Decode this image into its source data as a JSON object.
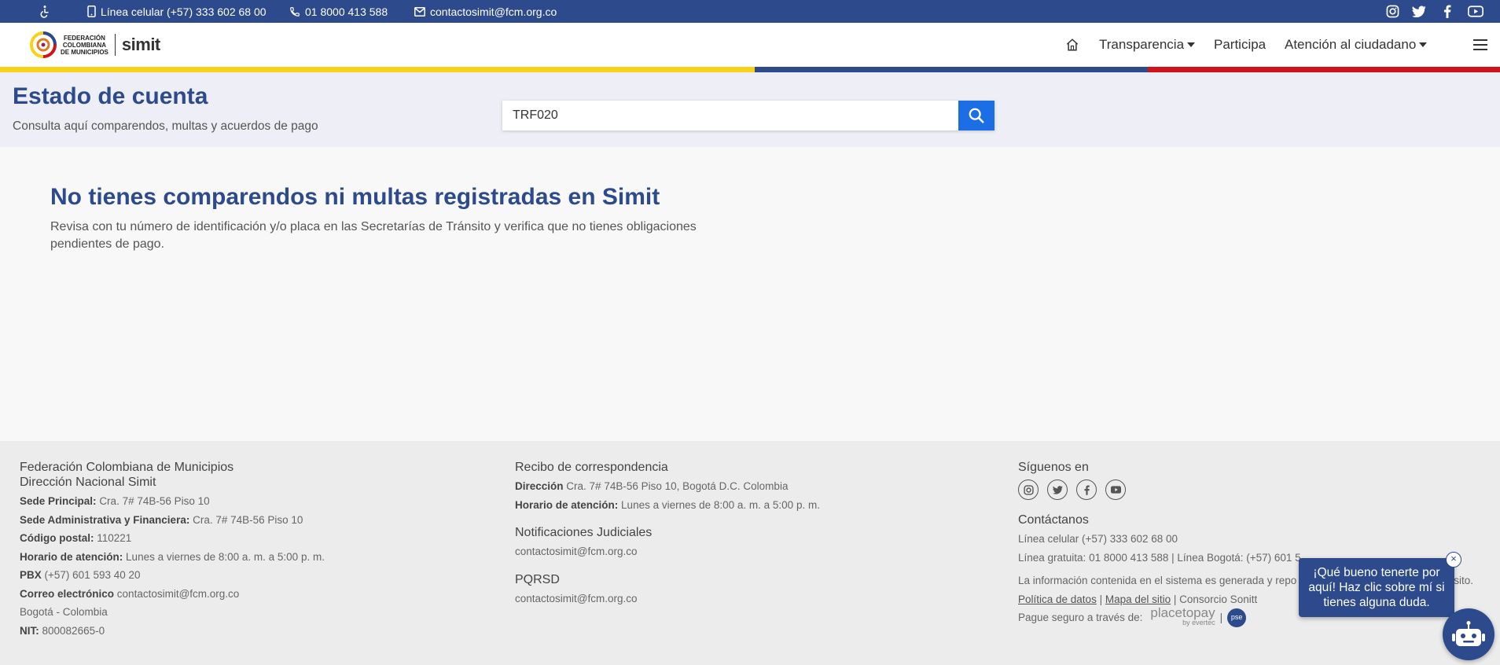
{
  "topbar": {
    "accessibility_icon": "wheelchair-icon",
    "phone_mobile": "Línea celular (+57) 333 602 68 00",
    "phone_line": "01 8000 413 588",
    "email": "contactosimit@fcm.org.co",
    "social_icons": [
      "instagram-icon",
      "twitter-icon",
      "facebook-icon",
      "youtube-icon"
    ]
  },
  "header": {
    "logo_text": [
      "FEDERACIÓN",
      "COLOMBIANA",
      "DE MUNICIPIOS"
    ],
    "logo_brand": "simit",
    "nav": {
      "home_icon": "home-icon",
      "transparencia": "Transparencia",
      "participa": "Participa",
      "atencion": "Atención al ciudadano",
      "menu_icon": "hamburger-menu-icon"
    }
  },
  "colors": {
    "primary": "#2c4a8c",
    "accent_blue": "#1c6ee5",
    "stripe_yellow": "#f7d218",
    "stripe_blue": "#2c4a8c",
    "stripe_red": "#d0121b"
  },
  "banner": {
    "title": "Estado de cuenta",
    "subtitle": "Consulta aquí comparendos, multas y acuerdos de pago",
    "search_value": "TRF020",
    "search_icon": "search-icon"
  },
  "main": {
    "title": "No tienes comparendos ni multas registradas en Simit",
    "text": "Revisa con tu número de identificación y/o placa en las Secretarías de Tránsito y verifica que no tienes obligaciones pendientes de pago."
  },
  "footer": {
    "col1": {
      "heading1": "Federación Colombiana de Municipios",
      "heading2": "Dirección Nacional Simit",
      "lines": [
        {
          "label": "Sede Principal:",
          "value": "Cra. 7# 74B-56 Piso 10"
        },
        {
          "label": "Sede Administrativa y Financiera:",
          "value": "Cra. 7# 74B-56 Piso 10"
        },
        {
          "label": "Código postal:",
          "value": "110221"
        },
        {
          "label": "Horario de atención:",
          "value": "Lunes a viernes de 8:00 a. m. a 5:00 p. m."
        },
        {
          "label": "PBX",
          "value": "(+57) 601 593 40 20"
        },
        {
          "label": "Correo electrónico",
          "value": "contactosimit@fcm.org.co"
        },
        {
          "label": "",
          "value": "Bogotá - Colombia"
        },
        {
          "label": "NIT:",
          "value": "800082665-0"
        }
      ]
    },
    "col2": {
      "heading": "Recibo de correspondencia",
      "direccion_label": "Dirección",
      "direccion_value": "Cra. 7# 74B-56 Piso 10, Bogotá D.C. Colombia",
      "horario_label": "Horario de atención:",
      "horario_value": "Lunes a viernes de 8:00 a. m. a 5:00 p. m.",
      "notif_heading": "Notificaciones Judiciales",
      "notif_email": "contactosimit@fcm.org.co",
      "pqrsd_heading": "PQRSD",
      "pqrsd_email": "contactosimit@fcm.org.co"
    },
    "col3": {
      "siguenos": "Síguenos en",
      "contactanos": "Contáctanos",
      "linea_celular": "Línea celular (+57) 333 602 68 00",
      "linea_gratuita": "Línea gratuita: 01 8000 413 588 | Línea Bogotá: (+57) 601 5",
      "info": "La información contenida en el sistema es generada y repo",
      "info_end": "sito.",
      "politica": "Política de datos",
      "mapa": "Mapa del sitio",
      "consorcio": "Consorcio Sonitt",
      "pague": "Pague seguro a través de:",
      "placetopay": "placetopay",
      "evertec": "by evertec",
      "pse": "pse"
    }
  },
  "chat": {
    "bubble": "¡Qué bueno tenerte por aquí! Haz clic sobre mí si tienes alguna duda.",
    "close": "×",
    "bot_icon": "chatbot-icon"
  }
}
